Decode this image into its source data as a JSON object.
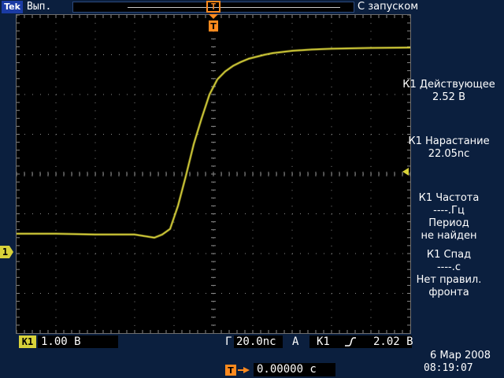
{
  "header": {
    "brand": "Tek",
    "run_status": "Вып.",
    "trigger_mode": "С запуском",
    "trigger_marker_label": "T"
  },
  "channel_marker": "1",
  "measurements": [
    {
      "title": "К1 Действующее",
      "value": "2.52 В"
    },
    {
      "title": "К1 Нарастание",
      "value": "22.05nc"
    },
    {
      "title": "К1 Частота",
      "value": "----.Гц",
      "extra": [
        "Период",
        "не найден"
      ]
    },
    {
      "title": "К1 Спад",
      "value": "----.с",
      "extra": [
        "Нет правил.",
        "фронта"
      ]
    }
  ],
  "status": {
    "channel_badge": "К1",
    "channel_scale": "1.00 В",
    "timebase_label": "Г",
    "timebase": "20.0nc",
    "trigger_type": "A",
    "trigger_source": "К1",
    "trigger_level": "2.02 В",
    "delay": "0.00000 с",
    "date": "6 Мар 2008",
    "time": "08:19:07"
  },
  "colors": {
    "background": "#0b1f3e",
    "trace": "#d8d23a",
    "marker": "#ff8a1e",
    "grid": "#8a8a8a"
  },
  "chart_data": {
    "type": "line",
    "title": "",
    "xlabel": "",
    "ylabel": "",
    "x_unit": "ns",
    "y_unit": "V",
    "grid": true,
    "x_divisions": 10,
    "y_divisions": 8,
    "volts_per_div": 1.0,
    "ns_per_div": 20.0,
    "xlim": [
      -100,
      100
    ],
    "ylim": [
      -4,
      4
    ],
    "series": [
      {
        "x": [
          -100,
          -80,
          -60,
          -40,
          -30,
          -26,
          -22,
          -18,
          -14,
          -10,
          -6,
          -2,
          2,
          6,
          10,
          14,
          18,
          22,
          26,
          30,
          40,
          50,
          60,
          80,
          100
        ],
        "values": [
          -1.5,
          -1.5,
          -1.52,
          -1.52,
          -1.6,
          -1.52,
          -1.38,
          -0.8,
          -0.05,
          0.75,
          1.4,
          2.0,
          2.38,
          2.58,
          2.72,
          2.82,
          2.9,
          2.95,
          3.0,
          3.04,
          3.1,
          3.13,
          3.15,
          3.17,
          3.18
        ]
      }
    ]
  }
}
